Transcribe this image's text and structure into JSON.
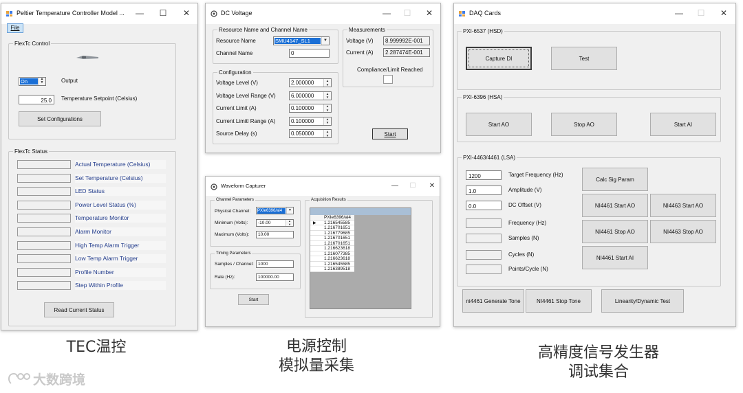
{
  "tec": {
    "title": "Peltier Temperature Controller Model ...",
    "menu_file": "File",
    "control_group": "FlexTc Control",
    "status_select": "On",
    "output_label": "Output",
    "setpoint_value": "25.0",
    "setpoint_label": "Temperature Setpoint (Celsius)",
    "set_config_button": "Set Configurations",
    "status_group": "FlexTc Status",
    "status_items": [
      "Actual Temperature (Celsius)",
      "Set Temperature (Celsius)",
      "LED Status",
      "Power Level Status (%)",
      "Temperature Monitor",
      "Alarm Monitor",
      "High Temp Alarm Trigger",
      "Low Temp Alarm Trigger",
      "Profile Number",
      "Step Within Profile"
    ],
    "read_status_button": "Read Current Status"
  },
  "dcv": {
    "title": "DC Voltage",
    "resource_group": "Resource Name and Channel Name",
    "resource_name_label": "Resource Name",
    "resource_name_value": "SMU4147_SL1",
    "channel_name_label": "Channel Name",
    "channel_name_value": "0",
    "measurements_group": "Measurements",
    "voltage_label": "Voltage (V)",
    "voltage_value": "8.999992E-001",
    "current_label": "Current (A)",
    "current_value": "2.287474E-001",
    "compliance_label": "Compliance/Limit Reached",
    "config_group": "Configuration",
    "config_items": [
      {
        "label": "Voltage Level (V)",
        "value": "2.000000"
      },
      {
        "label": "Voltage Level Range (V)",
        "value": "6.000000"
      },
      {
        "label": "Current Limit (A)",
        "value": "0.100000"
      },
      {
        "label": "Current Limitl Range (A)",
        "value": "0.100000"
      },
      {
        "label": "Source Delay (s)",
        "value": "0.050000"
      }
    ],
    "start_button": "Start"
  },
  "wave": {
    "title": "Waveform Capturer",
    "channel_group": "Channel Parameters",
    "physical_channel_label": "Physical Channel:",
    "physical_channel_value": "PXIe6396/ai4",
    "minimum_label": "Minimum (Volts):",
    "minimum_value": "-10.00",
    "maximum_label": "Maximum (Volts):",
    "maximum_value": "10.00",
    "timing_group": "Timing Parameters",
    "samples_label": "Samples / Channel:",
    "samples_value": "1000",
    "rate_label": "Rate (Hz):",
    "rate_value": "100000.00",
    "start_button": "Start",
    "results_group": "Acquisition Results",
    "results_header": "PXIe6396/ai4",
    "results_rows": [
      "1.216545585",
      "1.216701651",
      "1.216779685",
      "1.216701651",
      "1.216701651",
      "1.216623618",
      "1.216077385",
      "1.216623618",
      "1.216545585",
      "1.216389518"
    ]
  },
  "daq": {
    "title": "DAQ Cards",
    "hsd_group": "PXI-6537 (HSD)",
    "capture_di_button": "Capture DI",
    "test_button": "Test",
    "hsa_group": "PXI-6396 (HSA)",
    "start_ao_button": "Start AO",
    "stop_ao_button": "Stop AO",
    "start_ai_button": "Start AI",
    "lsa_group": "PXI-4463/4461 (LSA)",
    "target_freq_value": "1200",
    "target_freq_label": "Target Frequency (Hz)",
    "amplitude_value": "1.0",
    "amplitude_label": "Amplitude (V)",
    "dc_offset_value": "0.0",
    "dc_offset_label": "DC Offset (V)",
    "frequency_label": "Frequency (Hz)",
    "samples_label": "Samples (N)",
    "cycles_label": "Cycles (N)",
    "points_label": "Points/Cycle (N)",
    "calc_button": "Calc Sig Param",
    "ni4461_start_ao": "NI4461 Start AO",
    "ni4463_start_ao": "NI4463 Start AO",
    "ni4461_stop_ao": "NI4461 Stop AO",
    "ni4463_stop_ao": "NI4463 Stop AO",
    "ni4461_start_ai": "NI4461 Start AI",
    "gen_tone_button": "ni4461 Generate Tone",
    "stop_tone_button": "NI4461 Stop Tone",
    "linearity_button": "Linearity/Dynamic Test"
  },
  "captions": {
    "tec": "TEC温控",
    "power_line1": "电源控制",
    "power_line2": "模拟量采集",
    "gen_line1": "高精度信号发生器",
    "gen_line2": "调试集合"
  },
  "watermark": "大数跨境",
  "window_controls": {
    "minimize": "—",
    "maximize": "☐",
    "close": "✕"
  }
}
